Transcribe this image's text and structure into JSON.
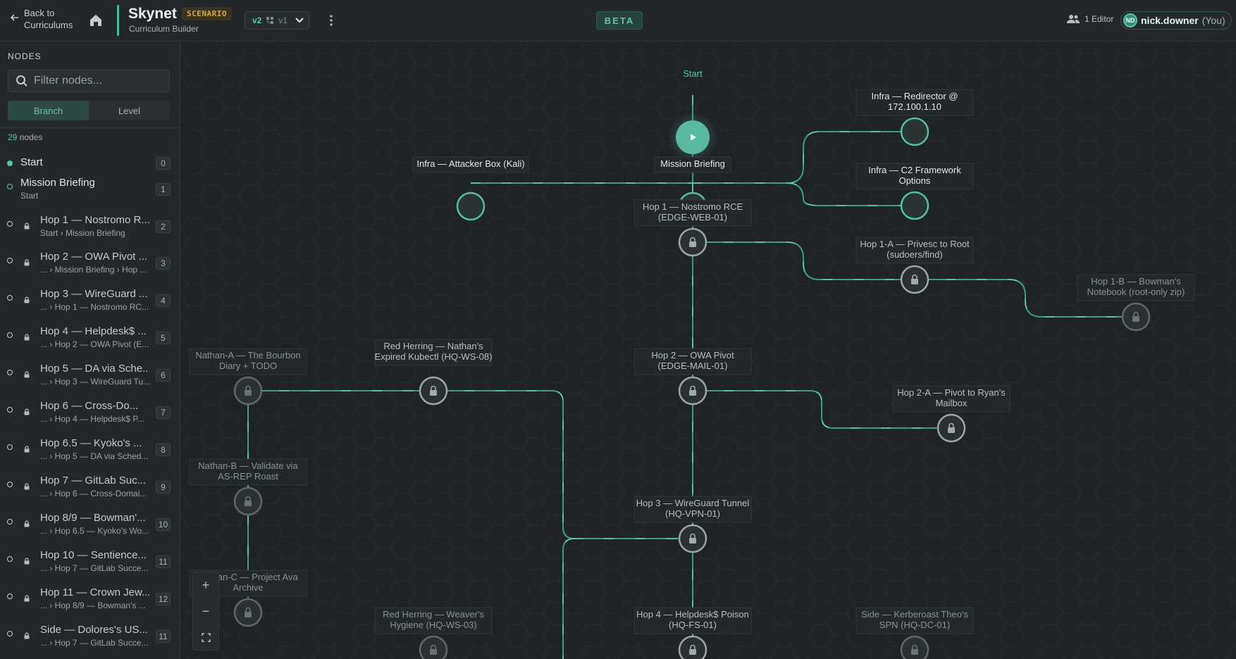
{
  "header": {
    "back_label": "Back to Curriculums",
    "title": "Skynet",
    "badge": "SCENARIO",
    "subtitle": "Curriculum Builder",
    "version_current": "v2",
    "version_other": "v1",
    "beta": "BETA",
    "editors_label": "1 Editor",
    "user_initials": "ND",
    "user_name": "nick.downer",
    "user_you": "(You)"
  },
  "sidebar": {
    "heading": "NODES",
    "filter_placeholder": "Filter nodes...",
    "tabs": [
      "Branch",
      "Level"
    ],
    "active_tab": "Branch",
    "count_value": "29",
    "count_suffix": "nodes",
    "items": [
      {
        "name": "Start",
        "sub": "",
        "num": "0",
        "status": "start",
        "locked": false
      },
      {
        "name": "Mission Briefing",
        "sub": "Start",
        "num": "1",
        "status": "open",
        "locked": false
      },
      {
        "name": "Hop 1 — Nostromo R...",
        "sub": "Start › Mission Briefing",
        "num": "2",
        "status": "locked",
        "locked": true
      },
      {
        "name": "Hop 2 — OWA Pivot ...",
        "sub": "... › Mission Briefing › Hop ...",
        "num": "3",
        "status": "locked",
        "locked": true
      },
      {
        "name": "Hop 3 — WireGuard ...",
        "sub": "... › Hop 1 — Nostromo RC...",
        "num": "4",
        "status": "locked",
        "locked": true
      },
      {
        "name": "Hop 4 — Helpdesk$ ...",
        "sub": "... › Hop 2 — OWA Pivot (E...",
        "num": "5",
        "status": "locked",
        "locked": true
      },
      {
        "name": "Hop 5 — DA via Sche...",
        "sub": "... › Hop 3 — WireGuard Tu...",
        "num": "6",
        "status": "locked",
        "locked": true
      },
      {
        "name": "Hop 6 — Cross-Do...",
        "sub": "... › Hop 4 — Helpdesk$ P...",
        "num": "7",
        "status": "locked",
        "locked": true
      },
      {
        "name": "Hop 6.5 — Kyoko's ...",
        "sub": "... › Hop 5 — DA via Sched...",
        "num": "8",
        "status": "locked",
        "locked": true
      },
      {
        "name": "Hop 7 — GitLab Suc...",
        "sub": "... › Hop 6 — Cross-Domai...",
        "num": "9",
        "status": "locked",
        "locked": true
      },
      {
        "name": "Hop 8/9 — Bowman'...",
        "sub": "... › Hop 6.5 — Kyoko's Wo...",
        "num": "10",
        "status": "locked",
        "locked": true
      },
      {
        "name": "Hop 10 — Sentience...",
        "sub": "... › Hop 7 — GitLab Succe...",
        "num": "11",
        "status": "locked",
        "locked": true
      },
      {
        "name": "Hop 11 — Crown Jew...",
        "sub": "... › Hop 8/9 — Bowman's ...",
        "num": "12",
        "status": "locked",
        "locked": true
      },
      {
        "name": "Side — Dolores's US...",
        "sub": "... › Hop 7 — GitLab Succe...",
        "num": "11",
        "status": "locked",
        "locked": true
      }
    ]
  },
  "graph": {
    "nodes": [
      {
        "id": "start",
        "label": "Start",
        "type": "start"
      },
      {
        "id": "mission",
        "label": "Mission Briefing",
        "type": "open"
      },
      {
        "id": "kali",
        "label": "Infra — Attacker Box (Kali)",
        "type": "open"
      },
      {
        "id": "redir",
        "label": "Infra — Redirector @ 172.100.1.10",
        "type": "open"
      },
      {
        "id": "c2",
        "label": "Infra — C2 Framework Options",
        "type": "open"
      },
      {
        "id": "hop1",
        "label": "Hop 1 — Nostromo RCE (EDGE-WEB-01)",
        "type": "locked"
      },
      {
        "id": "hop1a",
        "label": "Hop 1-A — Privesc to Root (sudoers/find)",
        "type": "locked"
      },
      {
        "id": "hop1b",
        "label": "Hop 1-B — Bowman's Notebook (root-only zip)",
        "type": "locked-dim"
      },
      {
        "id": "hop2",
        "label": "Hop 2 — OWA Pivot (EDGE-MAIL-01)",
        "type": "locked"
      },
      {
        "id": "hop2a",
        "label": "Hop 2-A — Pivot to Ryan's Mailbox",
        "type": "locked"
      },
      {
        "id": "rh1",
        "label": "Red Herring — Nathan's Expired Kubectl (HQ-WS-08)",
        "type": "locked"
      },
      {
        "id": "natha",
        "label": "Nathan-A — The Bourbon Diary + TODO",
        "type": "locked-dim"
      },
      {
        "id": "nathb",
        "label": "Nathan-B — Validate via AS-REP Roast",
        "type": "locked-dim"
      },
      {
        "id": "nathc",
        "label": "Nathan-C — Project Ava Archive",
        "type": "locked-dim"
      },
      {
        "id": "hop3",
        "label": "Hop 3 — WireGuard Tunnel (HQ-VPN-01)",
        "type": "locked"
      },
      {
        "id": "hop4",
        "label": "Hop 4 — Helpdesk$ Poison (HQ-FS-01)",
        "type": "locked"
      },
      {
        "id": "rh2",
        "label": "Red Herring — Weaver's Hygiene (HQ-WS-03)",
        "type": "locked-dim"
      },
      {
        "id": "side",
        "label": "Side — Kerberoast Theo's SPN (HQ-DC-01)",
        "type": "locked-dim"
      }
    ]
  },
  "zoom": {
    "in": "+",
    "out": "−",
    "fit": "fit-view"
  },
  "colors": {
    "accent": "#4bb89f",
    "edge": "#3f9b87",
    "lock": "#a0a7ab",
    "bg": "#1f2326"
  }
}
